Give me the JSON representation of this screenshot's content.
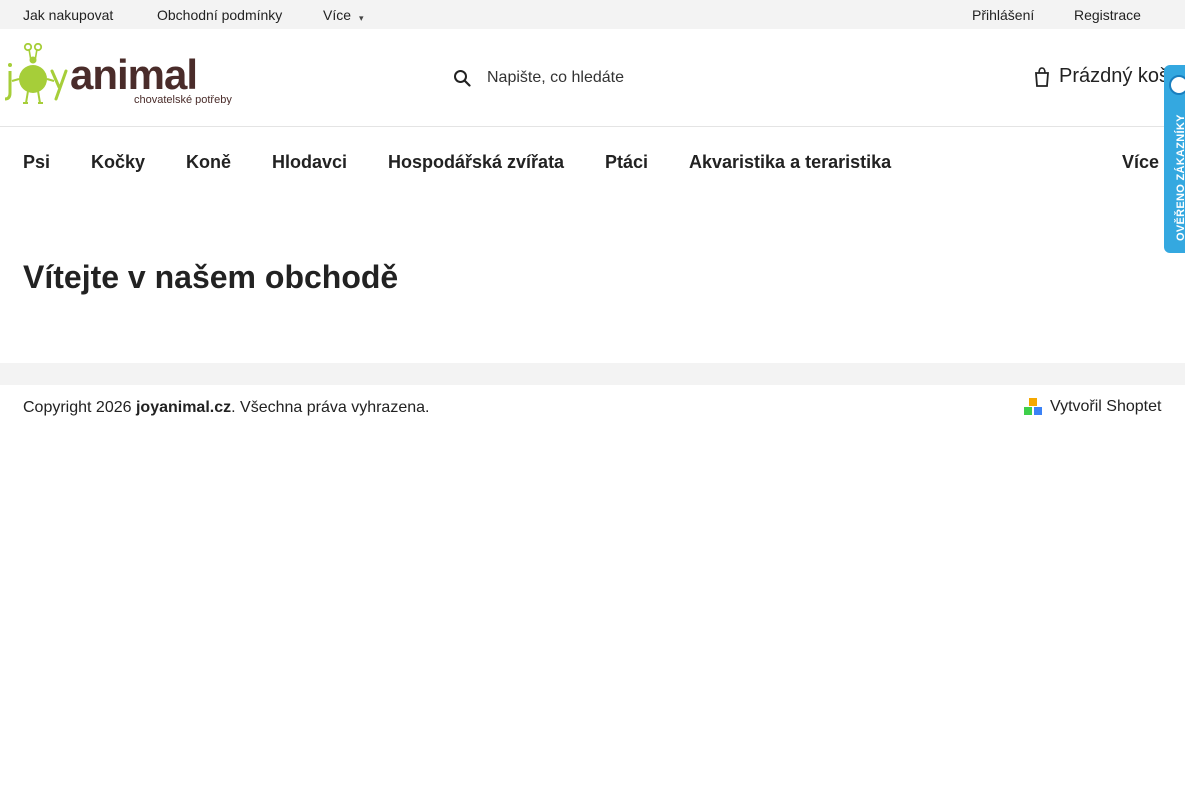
{
  "topbar": {
    "links": [
      "Jak nakupovat",
      "Obchodní podmínky",
      "Více"
    ],
    "login": "Přihlášení",
    "register": "Registrace"
  },
  "header": {
    "logo": {
      "word": "joyanimal",
      "tagline": "chovatelské potřeby"
    },
    "search_placeholder": "Napište, co hledáte",
    "cart_label": "Prázdný koš"
  },
  "nav": {
    "items": [
      "Psi",
      "Kočky",
      "Koně",
      "Hlodavci",
      "Hospodářská zvířata",
      "Ptáci",
      "Akvaristika a teraristika"
    ],
    "more": "Více"
  },
  "badge": {
    "text": "OVĚŘENO ZÁKAZNÍKY"
  },
  "main": {
    "title": "Vítejte v našem obchodě"
  },
  "footer": {
    "copyright_prefix": "Copyright 2026 ",
    "site": "joyanimal.cz",
    "copyright_suffix": ". Všechna práva vyhrazena.",
    "made_by": "Vytvořil Shoptet"
  },
  "colors": {
    "logo_green": "#a6ce39",
    "logo_brown": "#4a2c2a",
    "badge_blue": "#34a8e0",
    "bar_gray": "#f3f3f3"
  },
  "icons": {
    "search": "search-icon",
    "cart": "cart-icon",
    "caret": "chevron-down-icon"
  }
}
